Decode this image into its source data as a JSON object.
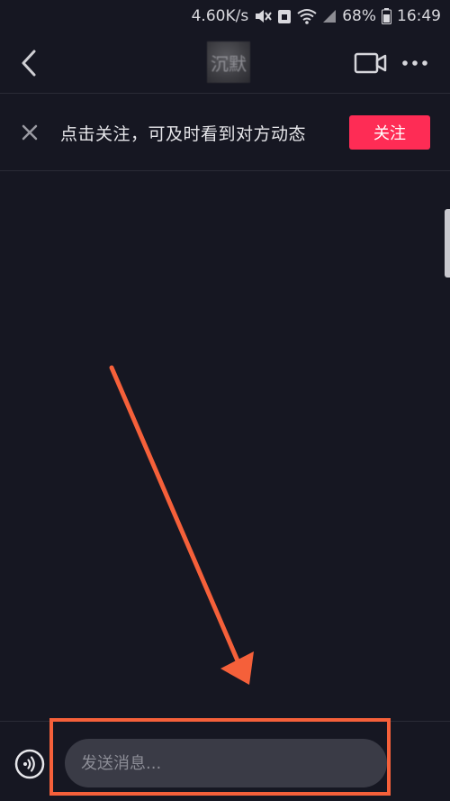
{
  "status_bar": {
    "net_speed": "4.60K/s",
    "battery": "68%",
    "time": "16:49"
  },
  "header": {
    "title": "沉默"
  },
  "follow_banner": {
    "message": "点击关注，可及时看到对方动态",
    "follow_label": "关注"
  },
  "input": {
    "placeholder": "发送消息..."
  },
  "colors": {
    "background": "#161722",
    "follow_button": "#fe2c55",
    "input_bg": "#3a3b46",
    "annotation": "#f5603a"
  }
}
